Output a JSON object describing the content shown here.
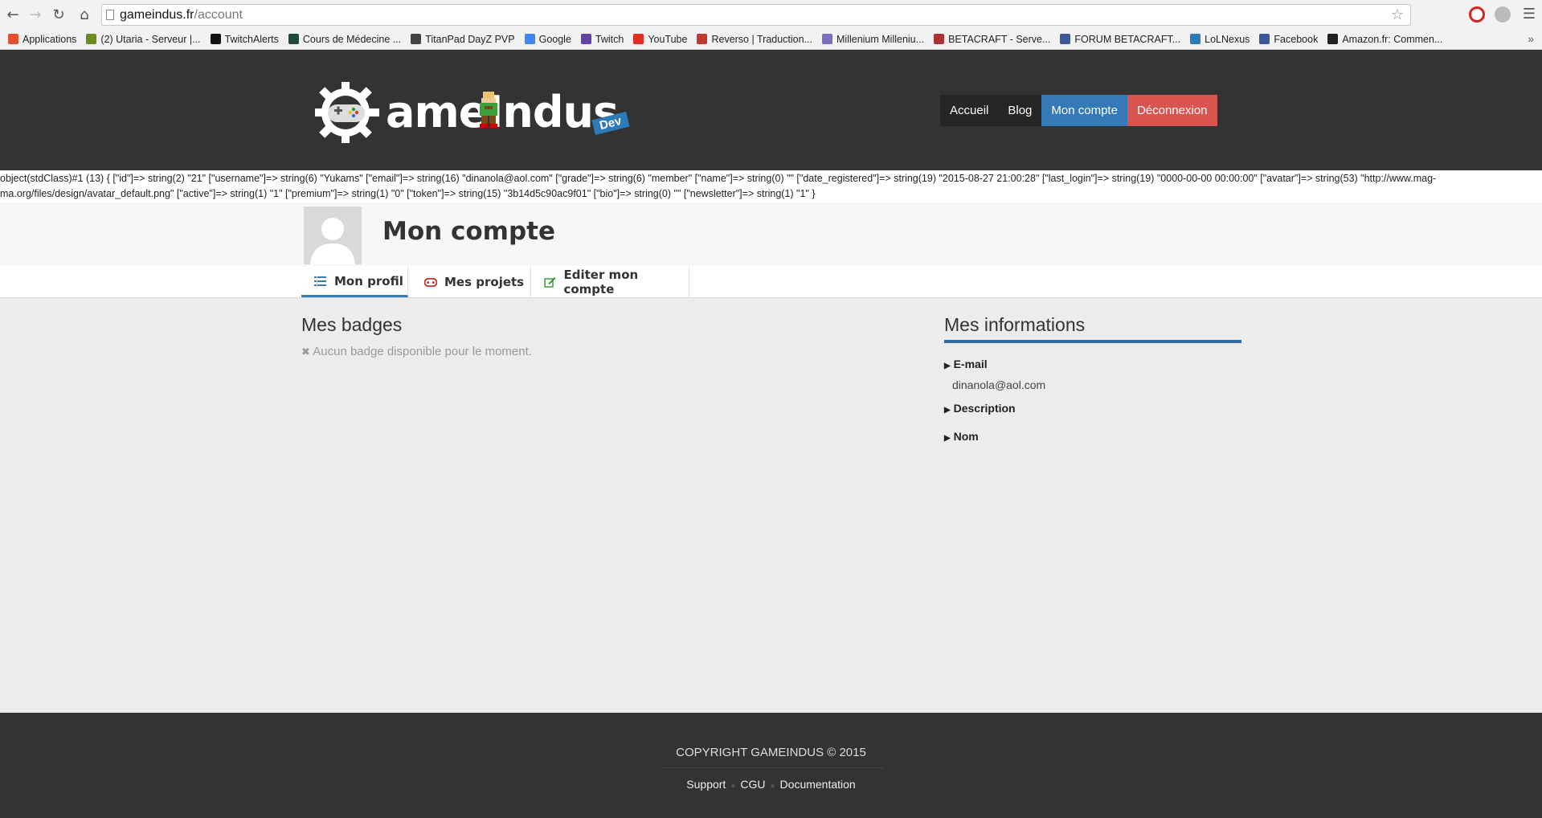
{
  "browser": {
    "url_host": "gameindus.fr",
    "url_path": "/account",
    "bookmarks": [
      {
        "label": "Applications",
        "icon": "apps-grid-icon",
        "color": "#e0502d"
      },
      {
        "label": "(2) Utaria - Serveur |...",
        "icon": "utaria-icon",
        "color": "#6b8e23"
      },
      {
        "label": "TwitchAlerts",
        "icon": "twitchalerts-icon",
        "color": "#111111"
      },
      {
        "label": "Cours de Médecine ...",
        "icon": "medecine-icon",
        "color": "#1e4a3a"
      },
      {
        "label": "TitanPad DayZ PVP",
        "icon": "titanpad-icon",
        "color": "#444444"
      },
      {
        "label": "Google",
        "icon": "google-icon",
        "color": "#4285f4"
      },
      {
        "label": "Twitch",
        "icon": "twitch-icon",
        "color": "#6441a5"
      },
      {
        "label": "YouTube",
        "icon": "youtube-icon",
        "color": "#e52d27"
      },
      {
        "label": "Reverso | Traduction...",
        "icon": "reverso-icon",
        "color": "#c0392b"
      },
      {
        "label": "Millenium Milleniu...",
        "icon": "millenium-icon",
        "color": "#7a6fbf"
      },
      {
        "label": "BETACRAFT - Serve...",
        "icon": "betacraft-icon",
        "color": "#a33"
      },
      {
        "label": "FORUM BETACRAFT...",
        "icon": "forum-betacraft-icon",
        "color": "#3b5998"
      },
      {
        "label": "LoLNexus",
        "icon": "lolnexus-icon",
        "color": "#2b7bb9"
      },
      {
        "label": "Facebook",
        "icon": "facebook-icon",
        "color": "#3b5998"
      },
      {
        "label": "Amazon.fr: Commen...",
        "icon": "amazon-icon",
        "color": "#222222"
      }
    ],
    "more": "»"
  },
  "header": {
    "logo_text": "ameIndus",
    "logo_badge": "Dev",
    "nav": [
      {
        "label": "Accueil",
        "style": "dark"
      },
      {
        "label": "Blog",
        "style": "dark"
      },
      {
        "label": "Mon compte",
        "style": "blue"
      },
      {
        "label": "Déconnexion",
        "style": "red"
      }
    ]
  },
  "debug_dump": "object(stdClass)#1 (13) { [\"id\"]=> string(2) \"21\" [\"username\"]=> string(6) \"Yukams\" [\"email\"]=> string(16) \"dinanola@aol.com\" [\"grade\"]=> string(6) \"member\" [\"name\"]=> string(0) \"\" [\"date_registered\"]=> string(19) \"2015-08-27 21:00:28\" [\"last_login\"]=> string(19) \"0000-00-00 00:00:00\" [\"avatar\"]=> string(53) \"http://www.mag-ma.org/files/design/avatar_default.png\" [\"active\"]=> string(1) \"1\" [\"premium\"]=> string(1) \"0\" [\"token\"]=> string(15) \"3b14d5c90ac9f01\" [\"bio\"]=> string(0) \"\" [\"newsletter\"]=> string(1) \"1\" }",
  "profile": {
    "title": "Mon compte",
    "tabs": [
      {
        "label": "Mon profil",
        "icon": "list-icon"
      },
      {
        "label": "Mes projets",
        "icon": "gamepad-icon"
      },
      {
        "label": "Editer mon compte",
        "icon": "edit-icon"
      }
    ]
  },
  "badges": {
    "title": "Mes badges",
    "empty": "Aucun badge disponible pour le moment."
  },
  "info": {
    "title": "Mes informations",
    "email_label": "E-mail",
    "email_value": "dinanola@aol.com",
    "description_label": "Description",
    "name_label": "Nom"
  },
  "footer": {
    "copyright": "COPYRIGHT GAMEINDUS © 2015",
    "links": [
      "Support",
      "CGU",
      "Documentation"
    ]
  },
  "colors": {
    "header_bg": "#333333",
    "accent_blue": "#337ab7",
    "danger_red": "#d9534f"
  }
}
